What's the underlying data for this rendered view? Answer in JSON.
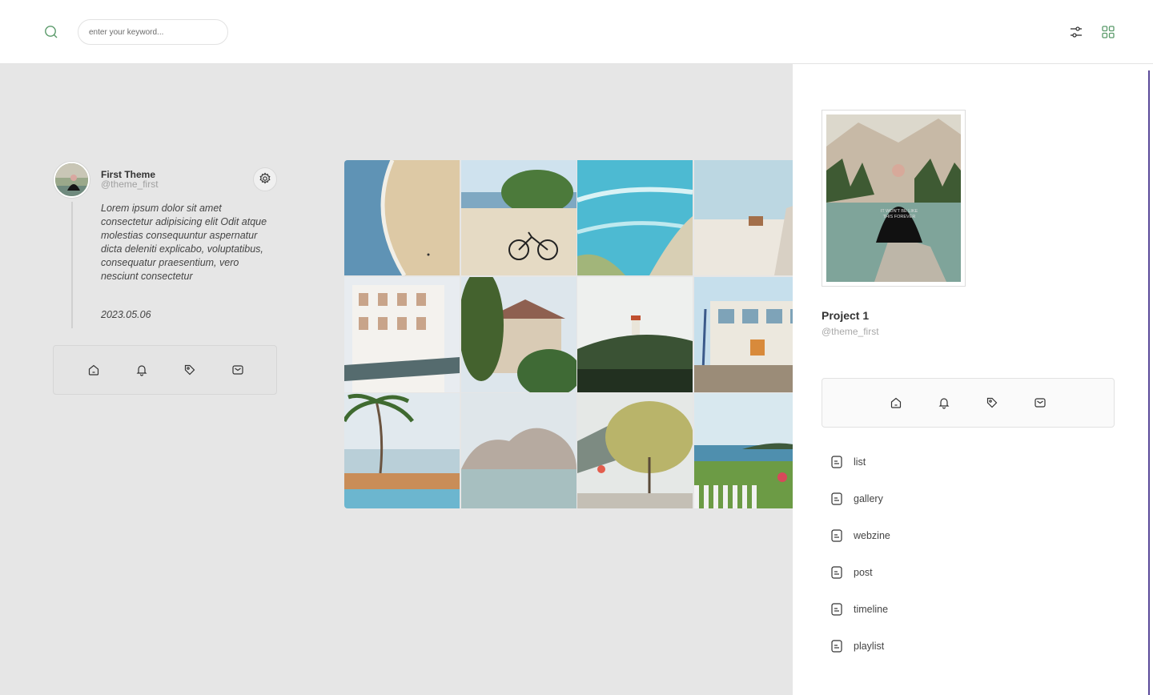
{
  "header": {
    "search_placeholder": "enter your keyword...",
    "search_value": "",
    "icons": [
      "search-icon",
      "sliders-icon",
      "grid-icon"
    ],
    "accent_color": "#5a9a6a"
  },
  "profile": {
    "name": "First Theme",
    "handle": "@theme_first",
    "post_text": "Lorem ipsum dolor sit amet consectetur adipisicing elit Odit atque molestias consequuntur aspernatur dicta deleniti explicabo, voluptatibus, consequatur praesentium, vero nesciunt consectetur",
    "date": "2023.05.06",
    "nav_icons": [
      "home-icon",
      "bell-icon",
      "tag-icon",
      "mail-icon"
    ]
  },
  "gallery": {
    "tiles": [
      "beach-aerial",
      "beach-bicycle",
      "turquoise-sea",
      "seaside-houses",
      "white-building",
      "villa-trees",
      "lighthouse",
      "school-yard",
      "palm-resort",
      "sea-rocks",
      "yellow-tree-road",
      "coast-garden"
    ]
  },
  "right_panel": {
    "project_title": "Project 1",
    "project_handle": "@theme_first",
    "nav_icons": [
      "home-icon",
      "bell-icon",
      "tag-icon",
      "mail-icon"
    ],
    "menu": [
      {
        "label": "list",
        "icon": "document-icon"
      },
      {
        "label": "gallery",
        "icon": "document-icon"
      },
      {
        "label": "webzine",
        "icon": "document-icon"
      },
      {
        "label": "post",
        "icon": "document-icon"
      },
      {
        "label": "timeline",
        "icon": "document-icon"
      },
      {
        "label": "playlist",
        "icon": "document-icon"
      }
    ],
    "accent_line_color": "#5b4a9a"
  }
}
